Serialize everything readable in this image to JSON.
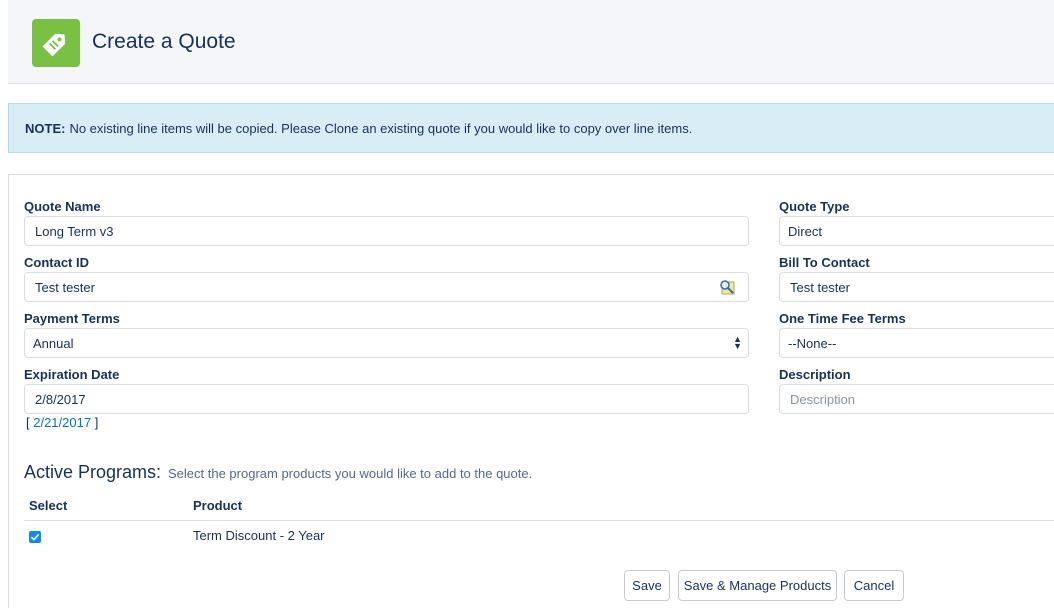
{
  "header": {
    "title": "Create a Quote",
    "icon": "tag-icon",
    "icon_color": "#7ac044"
  },
  "note": {
    "prefix": "NOTE:",
    "text": "No existing line items will be copied. Please Clone an existing quote if you would like to copy over line items."
  },
  "form": {
    "quote_name": {
      "label": "Quote Name",
      "value": "Long Term v3"
    },
    "quote_type": {
      "label": "Quote Type",
      "value": "Direct"
    },
    "contact_id": {
      "label": "Contact ID",
      "value": "Test tester"
    },
    "bill_to_contact": {
      "label": "Bill To Contact",
      "value": "Test tester"
    },
    "payment_terms": {
      "label": "Payment Terms",
      "value": "Annual"
    },
    "one_time_fee_terms": {
      "label": "One Time Fee Terms",
      "value": "--None--"
    },
    "expiration_date": {
      "label": "Expiration Date",
      "value": "2/8/2017",
      "today_link": "2/21/2017"
    },
    "description": {
      "label": "Description",
      "placeholder": "Description"
    }
  },
  "programs": {
    "title": "Active Programs:",
    "subtitle": "Select the program products you would like to add to the quote.",
    "columns": [
      "Select",
      "Product"
    ],
    "rows": [
      {
        "selected": true,
        "product": "Term Discount - 2 Year"
      }
    ]
  },
  "buttons": {
    "save": "Save",
    "save_manage": "Save & Manage Products",
    "cancel": "Cancel"
  },
  "colors": {
    "accent": "#1589ee",
    "link": "#0070d2",
    "note_bg": "#d8edf5"
  }
}
